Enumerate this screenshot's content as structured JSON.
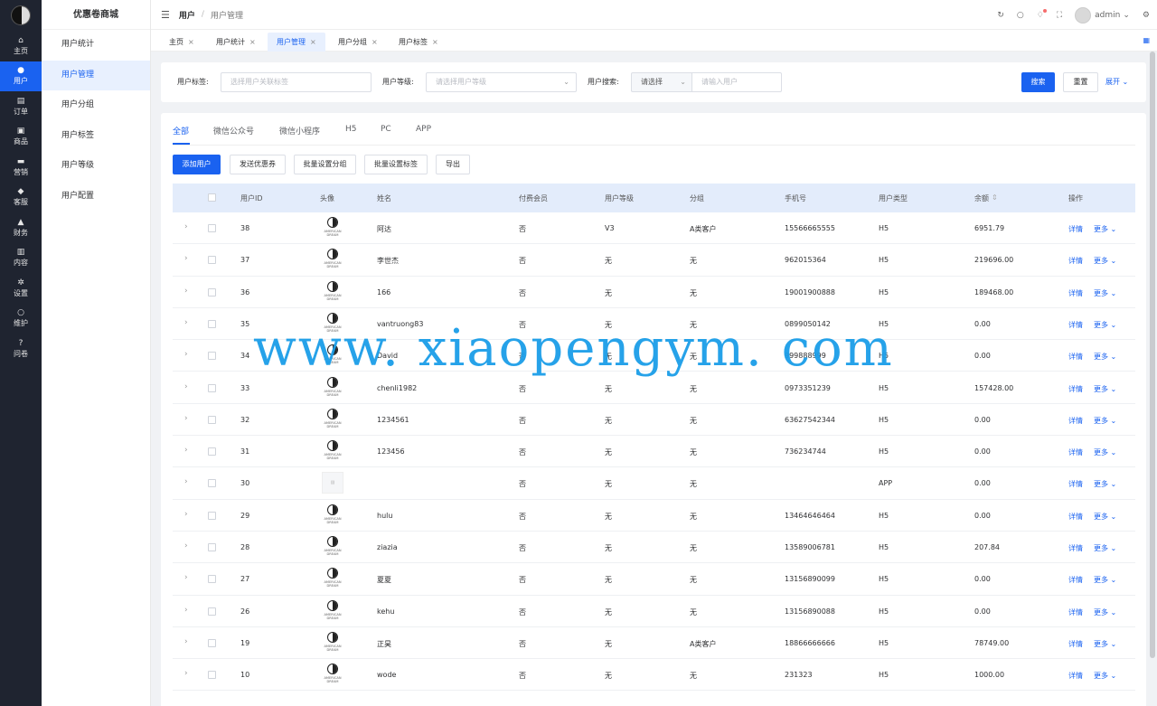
{
  "rail": {
    "items": [
      {
        "label": "主页",
        "icon": "home-icon"
      },
      {
        "label": "用户",
        "icon": "user-icon",
        "active": true
      },
      {
        "label": "订单",
        "icon": "order-icon"
      },
      {
        "label": "商品",
        "icon": "goods-icon"
      },
      {
        "label": "营销",
        "icon": "marketing-icon"
      },
      {
        "label": "客服",
        "icon": "service-icon"
      },
      {
        "label": "财务",
        "icon": "finance-icon"
      },
      {
        "label": "内容",
        "icon": "content-icon"
      },
      {
        "label": "设置",
        "icon": "gear-icon"
      },
      {
        "label": "维护",
        "icon": "maintain-icon"
      },
      {
        "label": "问卷",
        "icon": "question-icon"
      }
    ]
  },
  "submenu": {
    "title": "优惠卷商城",
    "items": [
      "用户统计",
      "用户管理",
      "用户分组",
      "用户标签",
      "用户等级",
      "用户配置"
    ]
  },
  "header": {
    "crumb_root": "用户",
    "crumb_current": "用户管理",
    "username": "admin"
  },
  "tabs": [
    "主页",
    "用户统计",
    "用户管理",
    "用户分组",
    "用户标签"
  ],
  "filter": {
    "tag_label": "用户标签:",
    "tag_placeholder": "选择用户关联标签",
    "level_label": "用户等级:",
    "level_placeholder": "请选择用户等级",
    "search_label": "用户搜索:",
    "search_type": "请选择",
    "search_placeholder": "请输入用户",
    "search_btn": "搜索",
    "reset_btn": "重置",
    "expand_btn": "展开"
  },
  "subtabs": [
    "全部",
    "微信公众号",
    "微信小程序",
    "H5",
    "PC",
    "APP"
  ],
  "toolbar": {
    "add_user": "添加用户",
    "send_coupon": "发送优惠券",
    "batch_group": "批量设置分组",
    "batch_tag": "批量设置标签",
    "export": "导出"
  },
  "table": {
    "headers": [
      "用户ID",
      "头像",
      "姓名",
      "付费会员",
      "用户等级",
      "分组",
      "手机号",
      "用户类型",
      "余额",
      "操作"
    ],
    "action_detail": "详情",
    "action_more": "更多",
    "avatar_caption": "AMERICAN DREAM",
    "rows": [
      {
        "id": "38",
        "name": "阿达",
        "paid": "否",
        "level": "V3",
        "group": "A类客户",
        "phone": "15566665555",
        "type": "H5",
        "balance": "6951.79",
        "avatar": true
      },
      {
        "id": "37",
        "name": "李世杰",
        "paid": "否",
        "level": "无",
        "group": "无",
        "phone": "962015364",
        "type": "H5",
        "balance": "219696.00",
        "avatar": true
      },
      {
        "id": "36",
        "name": "166",
        "paid": "否",
        "level": "无",
        "group": "无",
        "phone": "19001900888",
        "type": "H5",
        "balance": "189468.00",
        "avatar": true
      },
      {
        "id": "35",
        "name": "vantruong83",
        "paid": "否",
        "level": "无",
        "group": "无",
        "phone": "0899050142",
        "type": "H5",
        "balance": "0.00",
        "avatar": true
      },
      {
        "id": "34",
        "name": "David",
        "paid": "否",
        "level": "无",
        "group": "无",
        "phone": "999888999",
        "type": "H5",
        "balance": "0.00",
        "avatar": true
      },
      {
        "id": "33",
        "name": "chenli1982",
        "paid": "否",
        "level": "无",
        "group": "无",
        "phone": "0973351239",
        "type": "H5",
        "balance": "157428.00",
        "avatar": true
      },
      {
        "id": "32",
        "name": "1234561",
        "paid": "否",
        "level": "无",
        "group": "无",
        "phone": "63627542344",
        "type": "H5",
        "balance": "0.00",
        "avatar": true
      },
      {
        "id": "31",
        "name": "123456",
        "paid": "否",
        "level": "无",
        "group": "无",
        "phone": "736234744",
        "type": "H5",
        "balance": "0.00",
        "avatar": true
      },
      {
        "id": "30",
        "name": "",
        "paid": "否",
        "level": "无",
        "group": "无",
        "phone": "",
        "type": "APP",
        "balance": "0.00",
        "avatar": false
      },
      {
        "id": "29",
        "name": "hulu",
        "paid": "否",
        "level": "无",
        "group": "无",
        "phone": "13464646464",
        "type": "H5",
        "balance": "0.00",
        "avatar": true
      },
      {
        "id": "28",
        "name": "ziazia",
        "paid": "否",
        "level": "无",
        "group": "无",
        "phone": "13589006781",
        "type": "H5",
        "balance": "207.84",
        "avatar": true
      },
      {
        "id": "27",
        "name": "夏夏",
        "paid": "否",
        "level": "无",
        "group": "无",
        "phone": "13156890099",
        "type": "H5",
        "balance": "0.00",
        "avatar": true
      },
      {
        "id": "26",
        "name": "kehu",
        "paid": "否",
        "level": "无",
        "group": "无",
        "phone": "13156890088",
        "type": "H5",
        "balance": "0.00",
        "avatar": true
      },
      {
        "id": "19",
        "name": "正昊",
        "paid": "否",
        "level": "无",
        "group": "A类客户",
        "phone": "18866666666",
        "type": "H5",
        "balance": "78749.00",
        "avatar": true
      },
      {
        "id": "10",
        "name": "wode",
        "paid": "否",
        "level": "无",
        "group": "无",
        "phone": "231323",
        "type": "H5",
        "balance": "1000.00",
        "avatar": true
      }
    ]
  },
  "watermark": "www. xiaopengym. com",
  "colors": {
    "accent": "#1a62f0",
    "rail_bg": "#1f2430",
    "watermark": "#1b9ee8"
  }
}
